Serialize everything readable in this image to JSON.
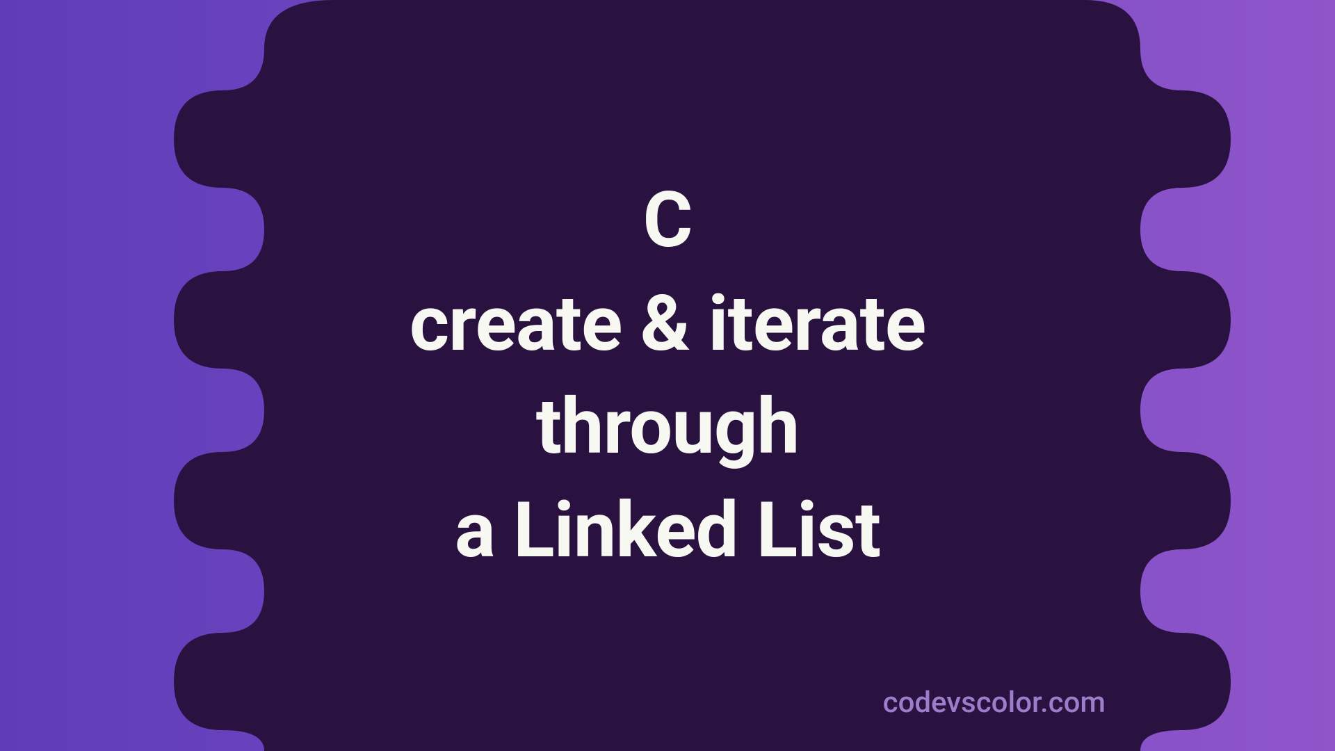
{
  "title": {
    "line1": "C",
    "line2": "create & iterate",
    "line3": "through",
    "line4": "a Linked List"
  },
  "watermark": "codevscolor.com",
  "colors": {
    "background_left": "#5f3db8",
    "background_right": "#8f55c9",
    "blob": "#2a1240",
    "text": "#f8f8f2",
    "watermark": "#9b7dc9"
  }
}
